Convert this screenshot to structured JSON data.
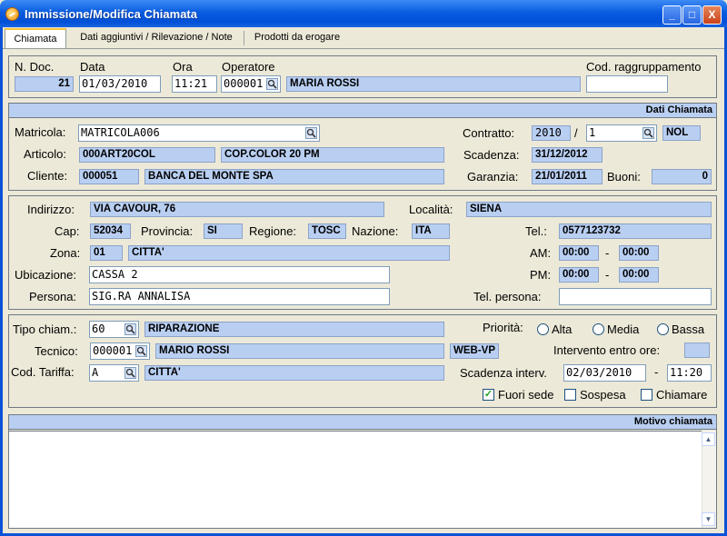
{
  "window": {
    "title": "Immissione/Modifica Chiamata",
    "minimize": "_",
    "maximize": "□",
    "close": "X"
  },
  "tabs": [
    "Chiamata",
    "Dati aggiuntivi / Rilevazione / Note",
    "Prodotti da erogare"
  ],
  "header": {
    "n_doc_label": "N. Doc.",
    "n_doc": "21",
    "data_label": "Data",
    "data": "01/03/2010",
    "ora_label": "Ora",
    "ora": "11:21",
    "operatore_label": "Operatore",
    "operatore_code": "000001",
    "operatore_name": "MARIA ROSSI",
    "cod_raggr_label": "Cod. raggruppamento",
    "cod_raggr": ""
  },
  "dati_chiamata": {
    "title": "Dati Chiamata",
    "matricola_label": "Matricola:",
    "matricola": "MATRICOLA006",
    "articolo_label": "Articolo:",
    "articolo_code": "000ART20COL",
    "articolo_desc": "COP.COLOR 20 PM",
    "cliente_label": "Cliente:",
    "cliente_code": "000051",
    "cliente_name": "BANCA DEL MONTE SPA",
    "contratto_label": "Contratto:",
    "contratto_year": "2010",
    "contratto_sep": "/",
    "contratto_num": "1",
    "contratto_type": "NOL",
    "scadenza_label": "Scadenza:",
    "scadenza": "31/12/2012",
    "garanzia_label": "Garanzia:",
    "garanzia": "21/01/2011",
    "buoni_label": "Buoni:",
    "buoni": "0"
  },
  "indirizzo": {
    "indirizzo_label": "Indirizzo:",
    "indirizzo": "VIA CAVOUR, 76",
    "localita_label": "Località:",
    "localita": "SIENA",
    "cap_label": "Cap:",
    "cap": "52034",
    "provincia_label": "Provincia:",
    "provincia": "SI",
    "regione_label": "Regione:",
    "regione": "TOSC",
    "nazione_label": "Nazione:",
    "nazione": "ITA",
    "tel_label": "Tel.:",
    "tel": "0577123732",
    "zona_label": "Zona:",
    "zona_code": "01",
    "zona_desc": "CITTA'",
    "am_label": "AM:",
    "am_from": "00:00",
    "am_to": "00:00",
    "pm_label": "PM:",
    "pm_from": "00:00",
    "pm_to": "00:00",
    "dash": "-",
    "ubicazione_label": "Ubicazione:",
    "ubicazione": "CASSA 2",
    "persona_label": "Persona:",
    "persona": "SIG.RA ANNALISA",
    "tel_persona_label": "Tel. persona:",
    "tel_persona": ""
  },
  "chiamata": {
    "tipo_label": "Tipo chiam.:",
    "tipo_code": "60",
    "tipo_desc": "RIPARAZIONE",
    "tecnico_label": "Tecnico:",
    "tecnico_code": "000001",
    "tecnico_name": "MARIO ROSSI",
    "tecnico_tag": "WEB-VP",
    "tariffa_label": "Cod. Tariffa:",
    "tariffa_code": "A",
    "tariffa_desc": "CITTA'",
    "priorita_label": "Priorità:",
    "priorita_options": [
      "Alta",
      "Media",
      "Bassa"
    ],
    "intervento_label": "Intervento entro ore:",
    "intervento_ore": "",
    "scad_interv_label": "Scadenza interv.",
    "scad_interv_date": "02/03/2010",
    "scad_interv_sep": "-",
    "scad_interv_time": "11:20",
    "fuori_sede_label": "Fuori sede",
    "fuori_sede_checked": true,
    "sospesa_label": "Sospesa",
    "chiamare_label": "Chiamare"
  },
  "motivo": {
    "title": "Motivo chiamata",
    "text": ""
  },
  "colors": {
    "readonly_bg": "#B9CFF2",
    "titlebar": "#0A5CE0",
    "face": "#ECE9D8"
  }
}
